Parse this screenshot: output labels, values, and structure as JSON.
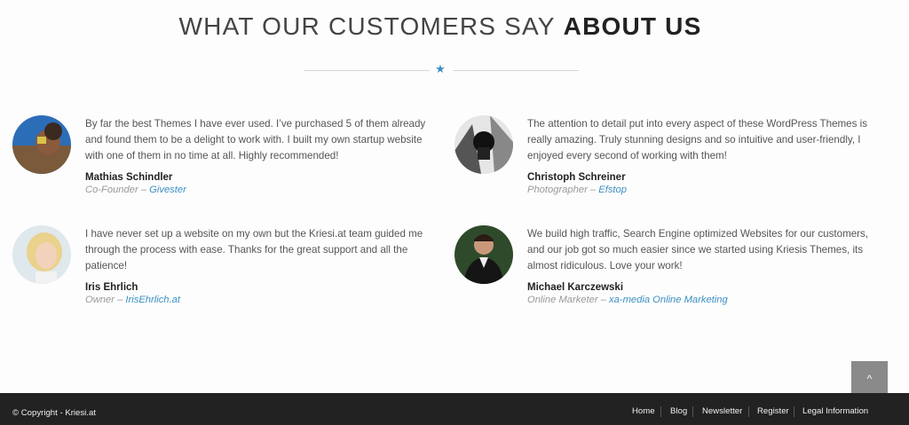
{
  "section": {
    "title_part1": "WHAT OUR CUSTOMERS SAY",
    "title_part2": "ABOUT US"
  },
  "testimonials": [
    {
      "quote": "By far the best Themes I have ever used.  I’ve purchased 5 of them already and found them to be a delight to work with. I built my own startup website with one of them in no time at all. Highly recommended!",
      "name": "Mathias Schindler",
      "role": "Co-Founder",
      "company": "Givester"
    },
    {
      "quote": "The attention to detail put into every aspect of these WordPress Themes is really amazing. Truly stunning designs and so intuitive and user-friendly, I enjoyed every second of working with them!",
      "name": "Christoph Schreiner",
      "role": "Photographer",
      "company": "Efstop"
    },
    {
      "quote": "I have never set up a website on my own but the Kriesi.at team guided me through the process with ease. Thanks for the great support and all the patience!",
      "name": "Iris Ehrlich",
      "role": "Owner",
      "company": "IrisEhrlich.at"
    },
    {
      "quote": "We build high traffic, Search Engine optimized Websites for our customers, and our job got so much easier since we started using Kriesis Themes, its almost ridiculous. Love your work!",
      "name": "Michael Karczewski",
      "role": "Online Marketer",
      "company": "xa-media Online Marketing"
    }
  ],
  "separator": "–",
  "scroll_top_icon": "^",
  "footer": {
    "copyright": "© Copyright - Kriesi.at",
    "menu": [
      "Home",
      "Blog",
      "Newsletter",
      "Register",
      "Legal Information"
    ]
  },
  "colors": {
    "accent": "#3b8fc2",
    "footer_bg": "#222222",
    "scroll_top_bg": "#8a8a8a"
  }
}
